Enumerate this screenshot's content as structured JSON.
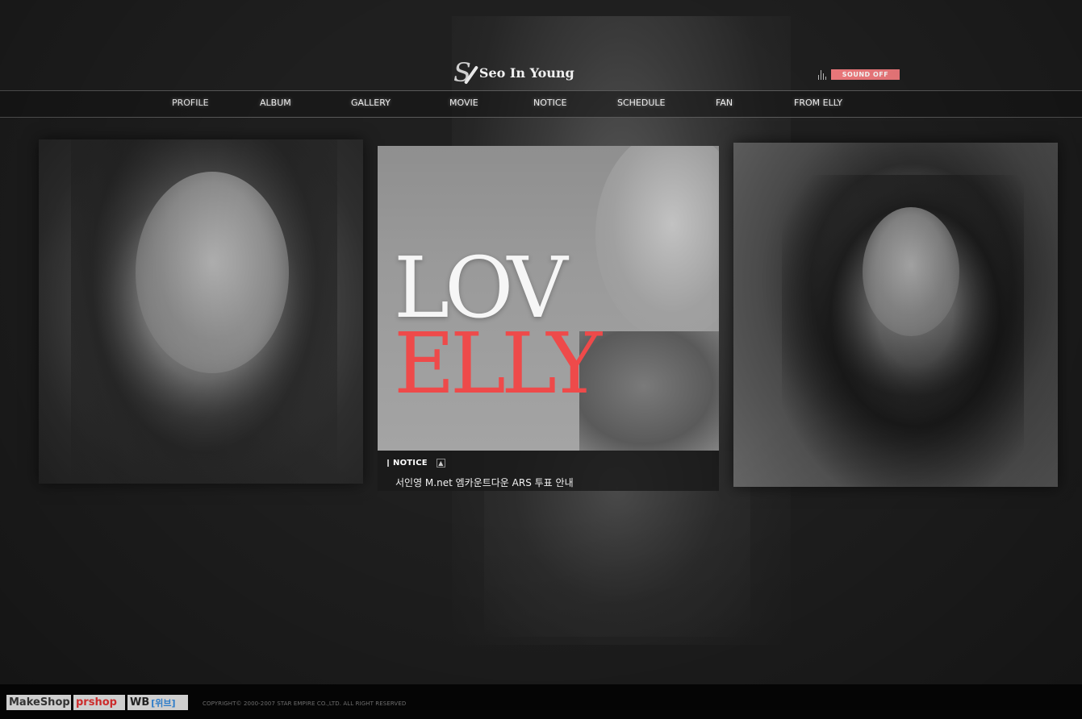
{
  "header": {
    "logo_mark": "S",
    "logo_text": "Seo In Young",
    "sound_label": "SOUND OFF"
  },
  "nav": {
    "items": [
      {
        "label": "PROFILE"
      },
      {
        "label": "ALBUM"
      },
      {
        "label": "GALLERY"
      },
      {
        "label": "MOVIE"
      },
      {
        "label": "NOTICE"
      },
      {
        "label": "SCHEDULE"
      },
      {
        "label": "FAN"
      },
      {
        "label": "FROM ELLY"
      }
    ]
  },
  "feature": {
    "line1": "LOV",
    "line2": "ELLY",
    "accent_color": "#ee4a4a"
  },
  "notice": {
    "label": "NOTICE",
    "more_icon": "arrow-up-icon",
    "item": "서인영 M.net 엠카운트다운 ARS 투표 안내"
  },
  "footer": {
    "badge1": "MakeShop",
    "badge2": "prshop",
    "badge3_main": "WB",
    "badge3_sub": "[위브]",
    "copyright": "COPYRIGHT© 2000-2007 STAR EMPIRE CO.,LTD. ALL RIGHT RESERVED"
  },
  "colors": {
    "background": "#1f1f1f",
    "sound_button": "#f27b7e"
  }
}
